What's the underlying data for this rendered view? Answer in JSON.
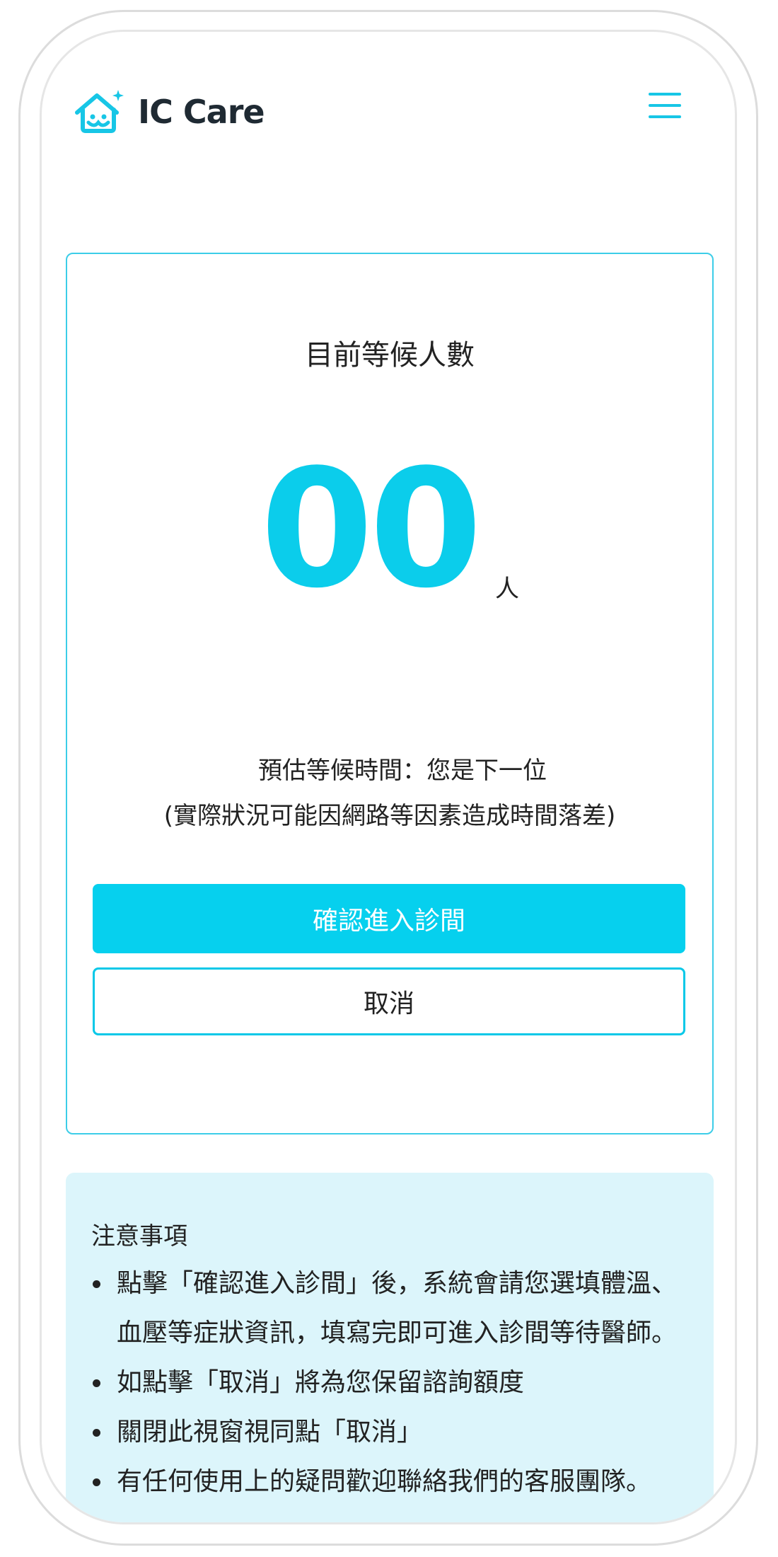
{
  "brand": {
    "name": "IC Care",
    "accent_color": "#06d0ee"
  },
  "queue": {
    "title": "目前等候人數",
    "count": "00",
    "unit": "人",
    "estimate_label": "預估等候時間：您是下一位",
    "disclaimer": "(實際狀況可能因網路等因素造成時間落差)"
  },
  "actions": {
    "confirm_label": "確認進入診間",
    "cancel_label": "取消"
  },
  "notice": {
    "title": "注意事項",
    "items": [
      "點擊「確認進入診間」後，系統會請您選填體溫、血壓等症狀資訊，填寫完即可進入診間等待醫師。",
      "如點擊「取消」將為您保留諮詢額度",
      "關閉此視窗視同點「取消」",
      "有任何使用上的疑問歡迎聯絡我們的客服團隊。"
    ]
  },
  "icons": {
    "logo": "house-sparkle-icon",
    "menu": "hamburger-menu-icon"
  }
}
